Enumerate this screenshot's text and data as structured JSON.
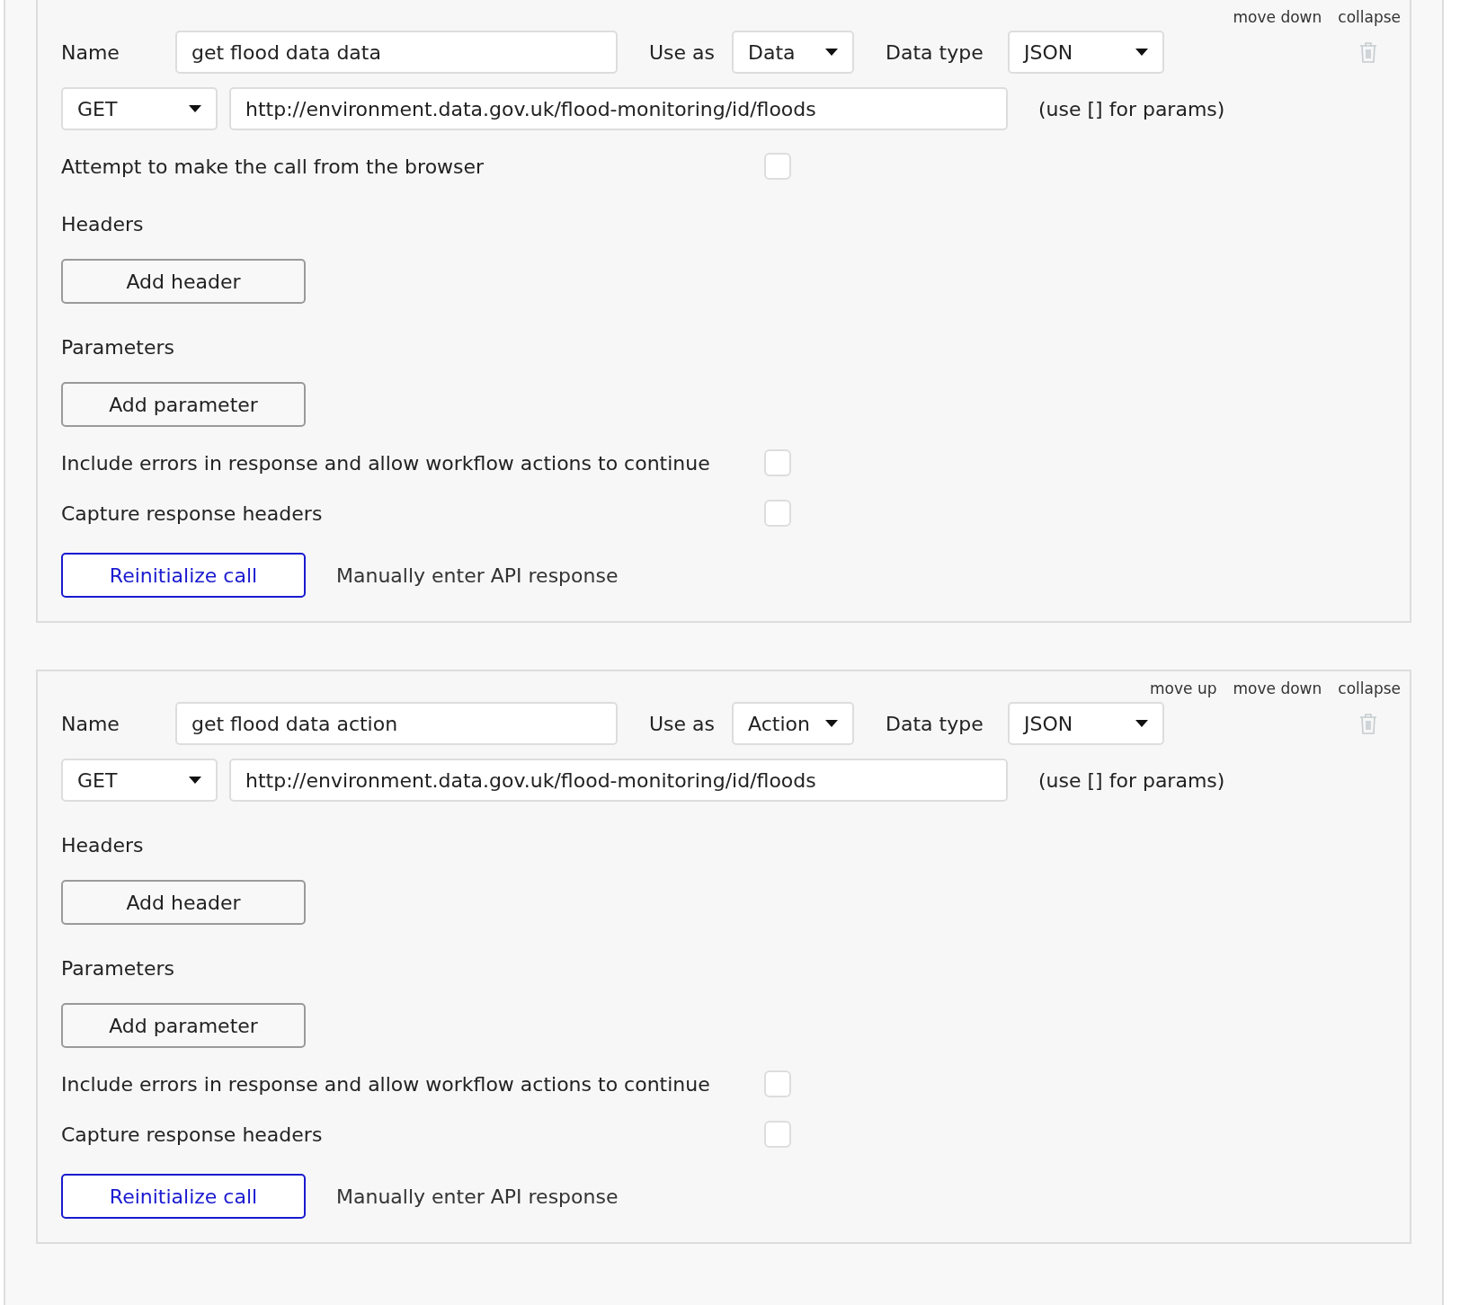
{
  "calls": [
    {
      "header_links": [
        "move down",
        "collapse"
      ],
      "name_label": "Name",
      "name": "get flood data data",
      "use_as_label": "Use as",
      "use_as": "Data",
      "data_type_label": "Data type",
      "data_type": "JSON",
      "method": "GET",
      "url": "http://environment.data.gov.uk/flood-monitoring/id/floods",
      "url_hint": "(use [] for params)",
      "items": [
        {
          "kind": "checkbox",
          "label": "Attempt to make the call from the browser",
          "checked": false
        },
        {
          "kind": "section",
          "label": "Headers",
          "button": "Add header"
        },
        {
          "kind": "section",
          "label": "Parameters",
          "button": "Add parameter"
        },
        {
          "kind": "checkbox",
          "label": "Include errors in response and allow workflow actions to continue",
          "checked": false
        },
        {
          "kind": "checkbox",
          "label": "Capture response headers",
          "checked": false
        },
        {
          "kind": "footer",
          "button": "Reinitialize call",
          "link": "Manually enter API response"
        }
      ]
    },
    {
      "header_links": [
        "move up",
        "move down",
        "collapse"
      ],
      "name_label": "Name",
      "name": "get flood data action",
      "use_as_label": "Use as",
      "use_as": "Action",
      "data_type_label": "Data type",
      "data_type": "JSON",
      "method": "GET",
      "url": "http://environment.data.gov.uk/flood-monitoring/id/floods",
      "url_hint": "(use [] for params)",
      "items": [
        {
          "kind": "section",
          "label": "Headers",
          "button": "Add header"
        },
        {
          "kind": "section",
          "label": "Parameters",
          "button": "Add parameter"
        },
        {
          "kind": "checkbox",
          "label": "Include errors in response and allow workflow actions to continue",
          "checked": false
        },
        {
          "kind": "checkbox",
          "label": "Capture response headers",
          "checked": false
        },
        {
          "kind": "footer",
          "button": "Reinitialize call",
          "link": "Manually enter API response"
        }
      ]
    }
  ]
}
